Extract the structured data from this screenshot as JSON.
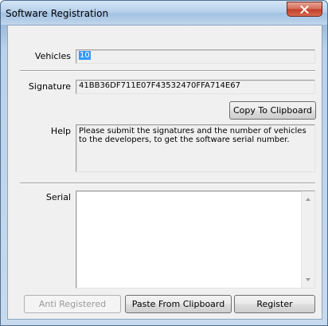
{
  "window": {
    "title": "Software Registration",
    "close_icon": "close-icon"
  },
  "form": {
    "vehicles_label": "Vehicles",
    "vehicles_value": "10",
    "signature_label": "Signature",
    "signature_value": "41BB36DF711E07F43532470FFA714E67",
    "copy_button": "Copy To Clipboard",
    "help_label": "Help",
    "help_text": "Please submit the signatures and the number of vehicles to the developers, to get the software serial number.",
    "serial_label": "Serial",
    "serial_value": ""
  },
  "footer": {
    "anti_registered": "Anti Registered",
    "paste_button": "Paste From Clipboard",
    "register_button": "Register"
  }
}
